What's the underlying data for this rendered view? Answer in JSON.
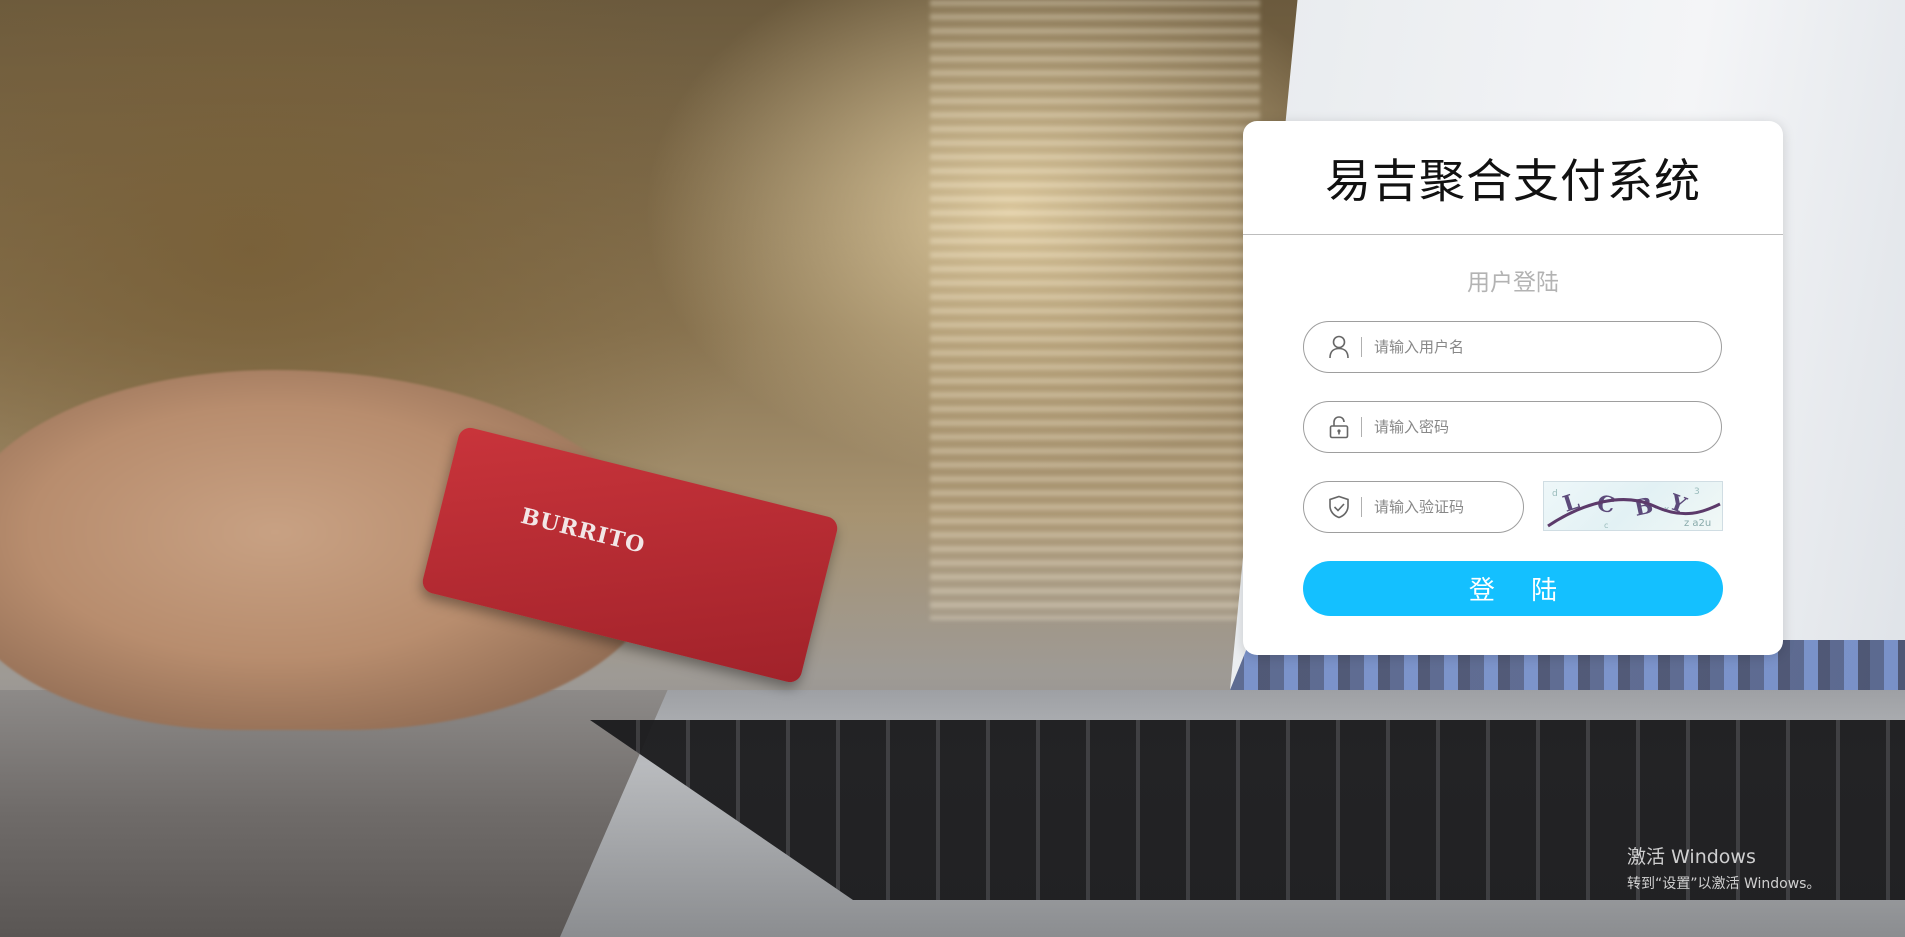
{
  "panel": {
    "title": "易吉聚合支付系统",
    "subtitle": "用户登陆"
  },
  "form": {
    "username": {
      "placeholder": "请输入用户名",
      "value": "",
      "icon": "user-icon"
    },
    "password": {
      "placeholder": "请输入密码",
      "value": "",
      "icon": "lock-icon"
    },
    "captcha": {
      "placeholder": "请输入验证码",
      "value": "",
      "icon": "shield-icon",
      "image_text": "LCBY"
    },
    "submit_label": "登 陆"
  },
  "background": {
    "card_text": "BURRITO"
  },
  "watermark": {
    "title": "激活 Windows",
    "subtitle": "转到“设置”以激活 Windows。"
  },
  "colors": {
    "accent": "#14c0ff",
    "panel_bg": "#ffffff",
    "subtitle": "#b3b3b3",
    "border": "#9e9e9e"
  }
}
